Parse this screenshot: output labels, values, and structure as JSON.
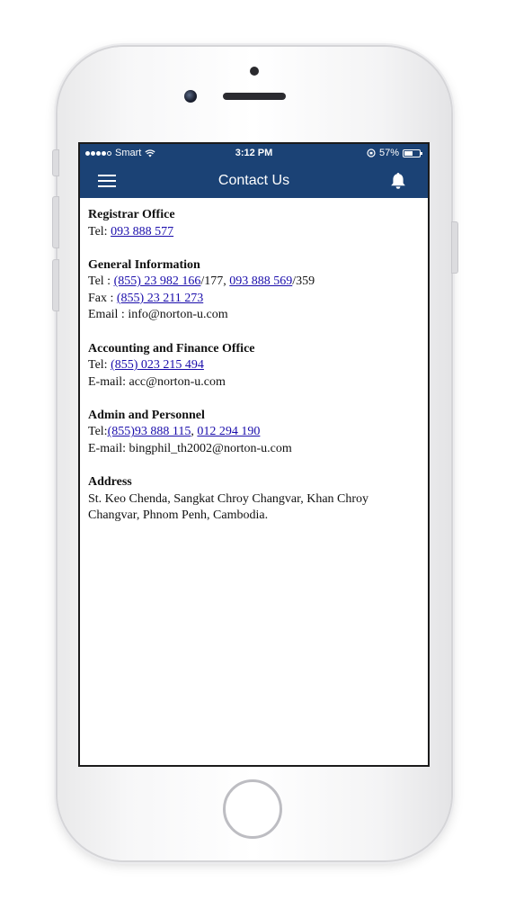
{
  "status_bar": {
    "carrier": "Smart",
    "time": "3:12 PM",
    "battery": "57%",
    "battery_level": 0.57
  },
  "header": {
    "title": "Contact Us",
    "menu_icon": "hamburger-menu-icon",
    "notification_icon": "bell-icon"
  },
  "colors": {
    "header_bg": "#1b4275",
    "link": "#1a0dab"
  },
  "sections": {
    "registrar": {
      "heading": "Registrar Office",
      "tel_label": "Tel: ",
      "tel_link": "093 888 577"
    },
    "general": {
      "heading": "General Information",
      "tel_label": "Tel : ",
      "tel_link_1": "(855) 23 982 166",
      "tel_ext_1": "/177, ",
      "tel_link_2": "093 888 569",
      "tel_ext_2": "/359",
      "fax_label": "Fax : ",
      "fax_link": "(855) 23 211 273",
      "email_line": "Email : info@norton-u.com"
    },
    "accounting": {
      "heading": "Accounting and Finance Office",
      "tel_label": "Tel: ",
      "tel_link": "(855) 023 215 494",
      "email_line": "E-mail: acc@norton-u.com"
    },
    "admin": {
      "heading": "Admin and Personnel",
      "tel_label": "Tel:",
      "tel_link_1": "(855)93 888 115",
      "tel_sep": ", ",
      "tel_link_2": "012 294 190",
      "email_line": "E-mail: bingphil_th2002@norton-u.com"
    },
    "address": {
      "heading": "Address",
      "text": "St. Keo Chenda, Sangkat Chroy Changvar, Khan Chroy Changvar, Phnom Penh, Cambodia."
    }
  }
}
